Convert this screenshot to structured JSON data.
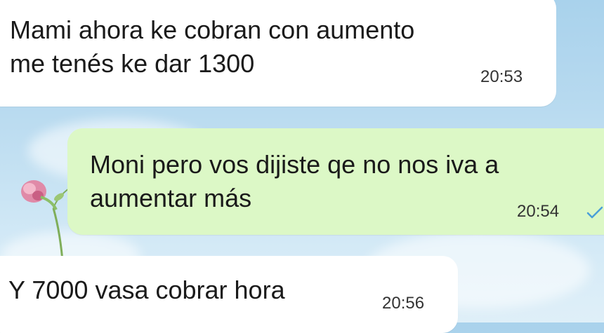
{
  "messages": [
    {
      "direction": "incoming",
      "lines": [
        "Mami ahora ke cobran con aumento",
        "me tenés ke dar 1300"
      ],
      "time": "20:53"
    },
    {
      "direction": "outgoing",
      "lines": [
        "Moni pero vos dijiste qe no nos iva a",
        "aumentar más"
      ],
      "time": "20:54",
      "status_icon": "single-check-icon"
    },
    {
      "direction": "incoming",
      "lines": [
        "Y 7000 vasa cobrar hora"
      ],
      "time": "20:56"
    }
  ],
  "colors": {
    "incoming_bubble": "#ffffff",
    "outgoing_bubble": "#dcf8c6",
    "check": "#4a9fd8"
  },
  "background_icon": "flower-wallpaper-icon"
}
